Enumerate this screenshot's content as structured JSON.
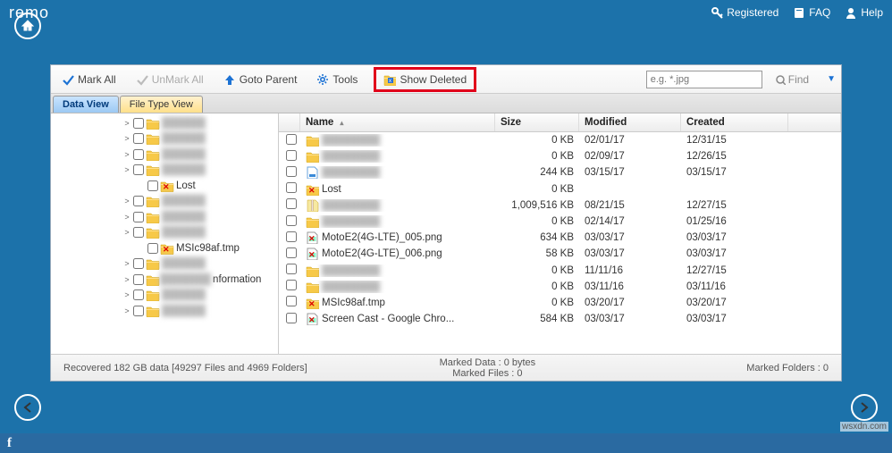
{
  "brand": "remo",
  "top_links": {
    "registered": "Registered",
    "faq": "FAQ",
    "help": "Help"
  },
  "toolbar": {
    "mark_all": "Mark All",
    "unmark_all": "UnMark All",
    "goto_parent": "Goto Parent",
    "tools": "Tools",
    "show_deleted": "Show Deleted",
    "search_placeholder": "e.g. *.jpg",
    "find": "Find"
  },
  "tabs": {
    "data_view": "Data View",
    "file_type_view": "File Type View"
  },
  "columns": {
    "name": "Name",
    "size": "Size",
    "modified": "Modified",
    "created": "Created"
  },
  "tree": [
    {
      "indent": 80,
      "expander": ">",
      "label": "",
      "blur": true
    },
    {
      "indent": 80,
      "expander": ">",
      "label": "",
      "blur": true
    },
    {
      "indent": 80,
      "expander": ">",
      "label": "",
      "blur": true
    },
    {
      "indent": 80,
      "expander": ">",
      "label": "",
      "blur": true
    },
    {
      "indent": 96,
      "expander": "",
      "label": "Lost",
      "deleted": true
    },
    {
      "indent": 80,
      "expander": ">",
      "label": "",
      "blur": true
    },
    {
      "indent": 80,
      "expander": ">",
      "label": "",
      "blur": true
    },
    {
      "indent": 80,
      "expander": ">",
      "label": "",
      "blur": true
    },
    {
      "indent": 96,
      "expander": "",
      "label": "MSIc98af.tmp",
      "deleted": true
    },
    {
      "indent": 80,
      "expander": ">",
      "label": "",
      "blur": true
    },
    {
      "indent": 80,
      "expander": ">",
      "label": "nformation",
      "partial": true
    },
    {
      "indent": 80,
      "expander": ">",
      "label": "",
      "blur": true
    },
    {
      "indent": 80,
      "expander": ">",
      "label": "",
      "blur": true
    }
  ],
  "rows": [
    {
      "icon": "folder",
      "name": "",
      "blur": true,
      "size": "0 KB",
      "modified": "02/01/17",
      "created": "12/31/15"
    },
    {
      "icon": "folder",
      "name": "",
      "blur": true,
      "size": "0 KB",
      "modified": "02/09/17",
      "created": "12/26/15"
    },
    {
      "icon": "docblue",
      "name": "",
      "blur": true,
      "size": "244 KB",
      "modified": "03/15/17",
      "created": "03/15/17"
    },
    {
      "icon": "folderx",
      "name": "Lost",
      "blur": false,
      "size": "0 KB",
      "modified": "",
      "created": ""
    },
    {
      "icon": "zip",
      "name": "",
      "blur": true,
      "size": "1,009,516 KB",
      "modified": "08/21/15",
      "created": "12/27/15"
    },
    {
      "icon": "folder",
      "name": "",
      "blur": true,
      "size": "0 KB",
      "modified": "02/14/17",
      "created": "01/25/16"
    },
    {
      "icon": "imgx",
      "name": "MotoE2(4G-LTE)_005.png",
      "blur": false,
      "size": "634 KB",
      "modified": "03/03/17",
      "created": "03/03/17"
    },
    {
      "icon": "imgx",
      "name": "MotoE2(4G-LTE)_006.png",
      "blur": false,
      "size": "58 KB",
      "modified": "03/03/17",
      "created": "03/03/17"
    },
    {
      "icon": "folder",
      "name": "",
      "blur": true,
      "size": "0 KB",
      "modified": "11/11/16",
      "created": "12/27/15"
    },
    {
      "icon": "folder",
      "name": "",
      "blur": true,
      "size": "0 KB",
      "modified": "03/11/16",
      "created": "03/11/16"
    },
    {
      "icon": "folderx",
      "name": "MSIc98af.tmp",
      "blur": false,
      "size": "0 KB",
      "modified": "03/20/17",
      "created": "03/20/17"
    },
    {
      "icon": "imgx",
      "name": "Screen Cast - Google Chro...",
      "blur": false,
      "size": "584 KB",
      "modified": "03/03/17",
      "created": "03/03/17"
    }
  ],
  "footer": {
    "recovered": "Recovered 182 GB data [49297 Files and 4969 Folders]",
    "marked_data": "Marked Data : 0 bytes",
    "marked_files": "Marked Files : 0",
    "marked_folders": "Marked Folders : 0"
  },
  "watermark": "wsxdn.com"
}
